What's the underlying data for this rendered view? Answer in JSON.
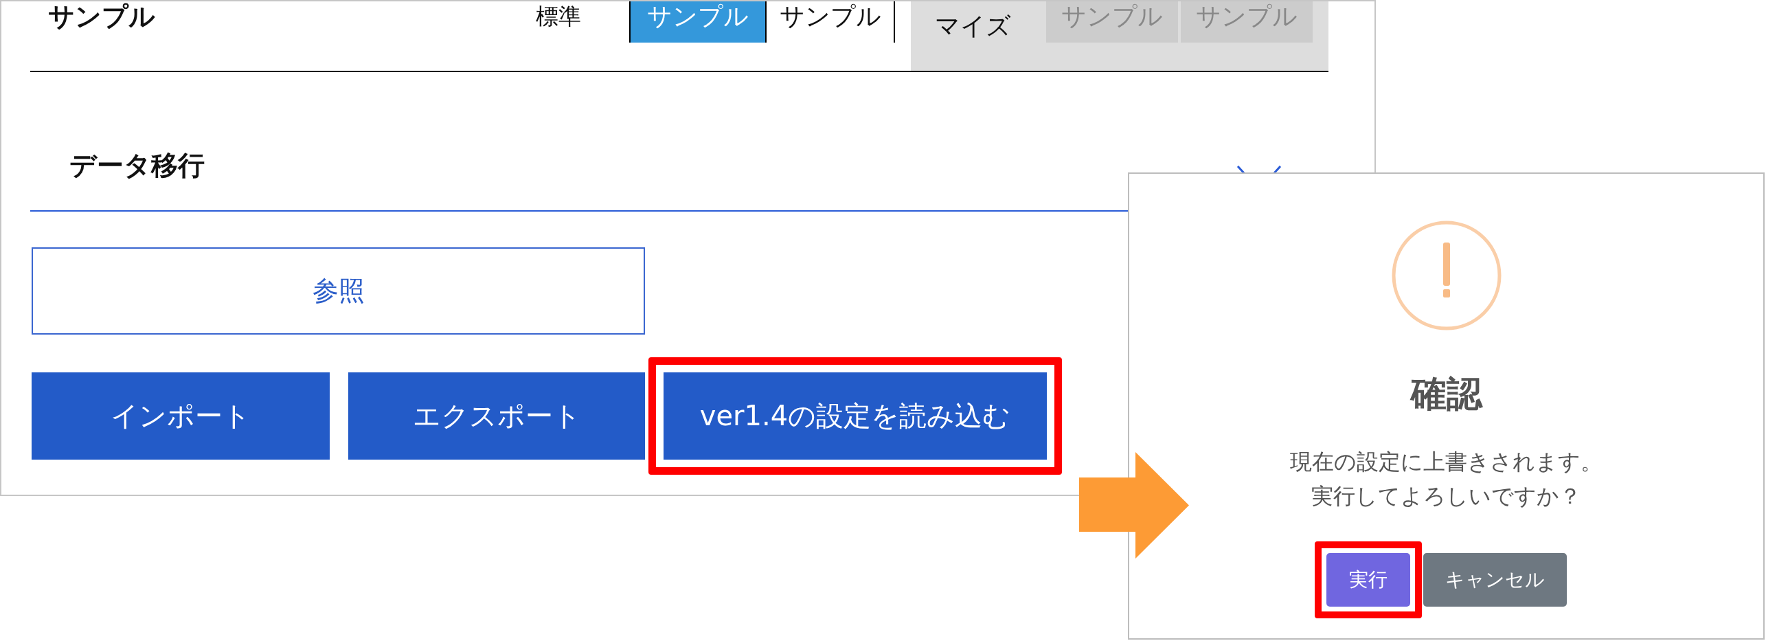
{
  "header": {
    "title": "サンプル",
    "mode_label": "標準",
    "tabs": [
      {
        "label": "サンプル",
        "selected": true
      },
      {
        "label": "サンプル",
        "selected": false
      }
    ],
    "custom_area": {
      "label": "マイズ",
      "tabs": [
        {
          "label": "サンプル",
          "disabled": true
        },
        {
          "label": "サンプル",
          "disabled": true
        }
      ]
    }
  },
  "section": {
    "title": "データ移行"
  },
  "browse_button": {
    "label": "参照"
  },
  "buttons": [
    {
      "label": "インポート",
      "highlighted": false
    },
    {
      "label": "エクスポート",
      "highlighted": false
    },
    {
      "label": "ver1.4の設定を読み込む",
      "highlighted": true
    }
  ],
  "dialog": {
    "title": "確認",
    "message_lines": [
      "現在の設定に上書きされます。",
      "実行してよろしいですか？"
    ],
    "buttons": [
      {
        "label": "実行",
        "kind": "confirm",
        "highlighted": true
      },
      {
        "label": "キャンセル",
        "kind": "cancel",
        "highlighted": false
      }
    ]
  }
}
